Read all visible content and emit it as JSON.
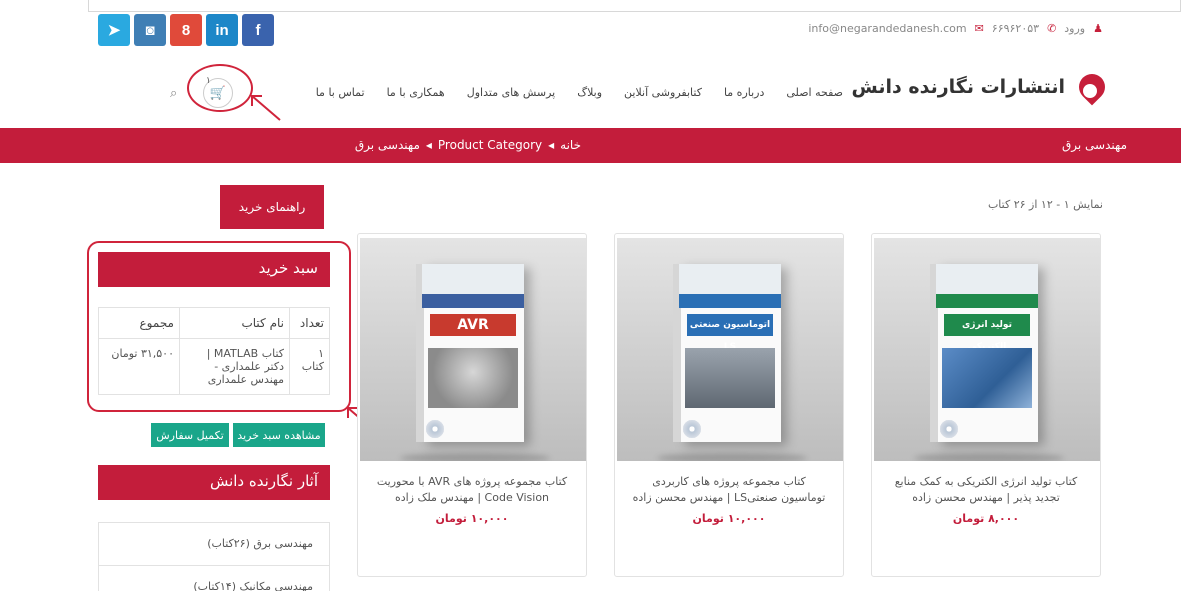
{
  "topbar": {
    "socials": [
      {
        "name": "telegram",
        "glyph": "➤"
      },
      {
        "name": "instagram",
        "glyph": "◙"
      },
      {
        "name": "google-plus",
        "glyph": "8"
      },
      {
        "name": "linkedin",
        "glyph": "in"
      },
      {
        "name": "facebook",
        "glyph": "f"
      }
    ],
    "email": "info@negarandedanesh.com",
    "phone": "۶۶۹۶۲۰۵۳",
    "login": "ورود"
  },
  "header": {
    "logo_text": "انتشارات نگارنده دانش",
    "nav": [
      "صفحه اصلی",
      "درباره ما",
      "کتابفروشی آنلاین",
      "وبلاگ",
      "پرسش های متداول",
      "همکاری با ما",
      "تماس با ما"
    ],
    "cart_count": "۱",
    "cart_glyph": "🛒",
    "search_glyph": "⌕"
  },
  "breadcrumb": {
    "page_title": "مهندسی برق",
    "home": "خانه",
    "category": "Product Category",
    "current": "مهندسی برق"
  },
  "sidebar": {
    "guide_button": "راهنمای خرید",
    "cart_title": "سبد خرید",
    "cart_headers": [
      "تعداد",
      "نام کتاب",
      "مجموع"
    ],
    "cart_rows": [
      {
        "qty": "۱ کتاب",
        "name": "کتاب MATLAB | دکتر علمداری - مهندس علمداری",
        "total": "۳۱,۵۰۰ تومان"
      }
    ],
    "view_cart_button": "مشاهده سبد خرید",
    "checkout_button": "تکمیل سفارش",
    "works_title": "آثار نگارنده دانش",
    "categories": [
      "مهندسی برق (۲۶کتاب)",
      "مهندسی مکانیک (۱۴کتاب)"
    ]
  },
  "main": {
    "showing": "نمایش ۱ - ۱۲ از ۲۶ کتاب",
    "products": [
      {
        "name": "کتاب تولید انرژی الکتریکی به کمک منابع تجدید پذیر | مهندس محسن زاده",
        "price": "۸,۰۰۰ تومان",
        "cover_title": "تولید انرژی الکتریکی",
        "cover_color": "#1f8a4c"
      },
      {
        "name": "کتاب مجموعه پروژه های کاربردی توماسیون صنعتیLS | مهندس محسن زاده",
        "price": "۱۰,۰۰۰ تومان",
        "cover_title": "اتوماسیون صنعتی LS",
        "cover_color": "#2a6fb5"
      },
      {
        "name": "کتاب مجموعه پروژه های AVR با محوریت Code Vision | مهندس ملک زاده",
        "price": "۱۰,۰۰۰ تومان",
        "cover_title": "AVR",
        "cover_color": "#c83a2e"
      }
    ]
  },
  "colors": {
    "brand_red": "#c31d3b",
    "green": "#1aa68a",
    "social_blue": "#2aa9e0"
  }
}
